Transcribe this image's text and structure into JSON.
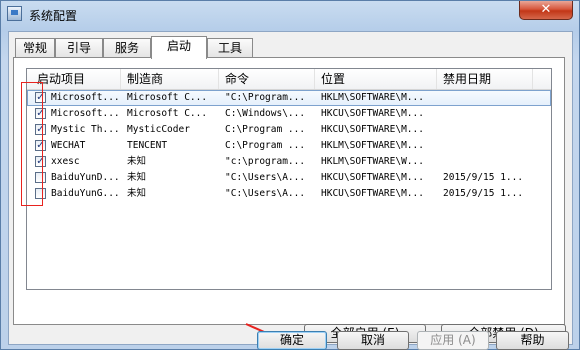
{
  "window": {
    "title": "系统配置",
    "close_glyph": "✕"
  },
  "tabs": [
    {
      "label": "常规"
    },
    {
      "label": "引导"
    },
    {
      "label": "服务"
    },
    {
      "label": "启动"
    },
    {
      "label": "工具"
    }
  ],
  "active_tab": "启动",
  "table": {
    "columns": [
      "启动项目",
      "制造商",
      "命令",
      "位置",
      "禁用日期"
    ],
    "rows": [
      {
        "checked": true,
        "item": "Microsoft...",
        "maker": "Microsoft C...",
        "command": "\"C:\\Program...",
        "location": "HKLM\\SOFTWARE\\M...",
        "date": ""
      },
      {
        "checked": true,
        "item": "Microsoft...",
        "maker": "Microsoft C...",
        "command": "C:\\Windows\\...",
        "location": "HKCU\\SOFTWARE\\M...",
        "date": ""
      },
      {
        "checked": true,
        "item": "Mystic Th...",
        "maker": "MysticCoder",
        "command": "C:\\Program ...",
        "location": "HKCU\\SOFTWARE\\M...",
        "date": ""
      },
      {
        "checked": true,
        "item": "WECHAT",
        "maker": "TENCENT",
        "command": "C:\\Program ...",
        "location": "HKLM\\SOFTWARE\\M...",
        "date": ""
      },
      {
        "checked": true,
        "item": "xxesc",
        "maker": "未知",
        "command": "\"c:\\program...",
        "location": "HKLM\\SOFTWARE\\W...",
        "date": ""
      },
      {
        "checked": false,
        "item": "BaiduYunD...",
        "maker": "未知",
        "command": "\"C:\\Users\\A...",
        "location": "HKCU\\SOFTWARE\\M...",
        "date": "2015/9/15 1..."
      },
      {
        "checked": false,
        "item": "BaiduYunG...",
        "maker": "未知",
        "command": "\"C:\\Users\\A...",
        "location": "HKCU\\SOFTWARE\\M...",
        "date": "2015/9/15 1..."
      }
    ],
    "selected_row": 0
  },
  "buttons": {
    "enable_all": "全部启用 (E)",
    "disable_all": "全部禁用 (D)",
    "ok": "确定",
    "cancel": "取消",
    "apply": "应用 (A)",
    "help": "帮助"
  },
  "colors": {
    "annotation_red": "#e8231f",
    "check_mark": "#223a7a"
  }
}
